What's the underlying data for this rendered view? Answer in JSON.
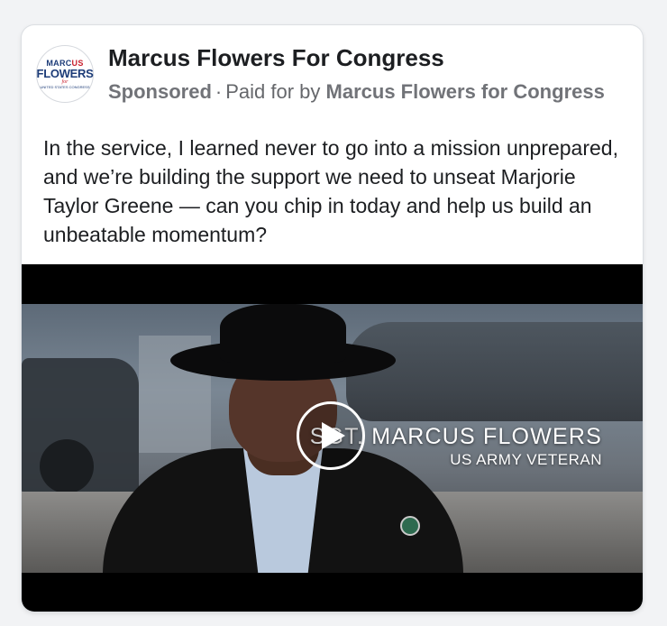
{
  "ad": {
    "avatar": {
      "line1_a": "MARC",
      "line1_b": "US",
      "line2": "FLOWERS",
      "line3": "for",
      "line4": "UNITED STATES CONGRESS"
    },
    "page_name": "Marcus Flowers For Congress",
    "sponsored_label": "Sponsored",
    "separator": "·",
    "paid_for_prefix": "Paid for by",
    "paid_for_name": "Marcus Flowers for Congress",
    "body_text": "In the service, I learned never to go into a mission unprepared, and we’re building the support we need to unseat Marjorie Taylor Greene — can you chip in today and help us build an unbeatable momentum?"
  },
  "video": {
    "title_line": "SGT. MARCUS FLOWERS",
    "subtitle_line": "US ARMY VETERAN",
    "play_icon": "play-icon"
  },
  "colors": {
    "page_name": "#1c1e21",
    "meta": "#65676b",
    "logo_blue": "#1d3c78",
    "logo_red": "#c8202e"
  }
}
